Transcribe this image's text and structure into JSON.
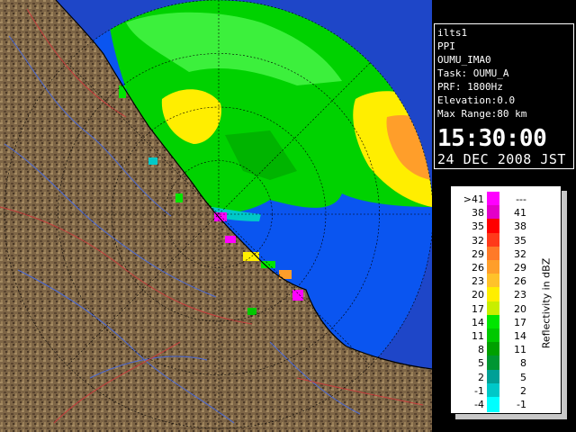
{
  "info": {
    "lines": [
      "ilts1",
      "PPI",
      "OUMU_IMA0",
      "Task: OUMU_A",
      "PRF: 1800Hz",
      "Elevation:0.0",
      "Max Range:80 km"
    ],
    "time": "15:30:00",
    "date": "24 DEC 2008 JST"
  },
  "legend": {
    "unit_label": "Reflectivity in dBZ",
    "rows": [
      {
        "lo": ">41",
        "hi": "---",
        "color": "#ff00ff"
      },
      {
        "lo": "38",
        "hi": "41",
        "color": "#e300c9"
      },
      {
        "lo": "35",
        "hi": "38",
        "color": "#ff0000"
      },
      {
        "lo": "32",
        "hi": "35",
        "color": "#ff3a1a"
      },
      {
        "lo": "29",
        "hi": "32",
        "color": "#ff7a28"
      },
      {
        "lo": "26",
        "hi": "29",
        "color": "#ff9e2a"
      },
      {
        "lo": "23",
        "hi": "26",
        "color": "#ffc22a"
      },
      {
        "lo": "20",
        "hi": "23",
        "color": "#ffee00"
      },
      {
        "lo": "17",
        "hi": "20",
        "color": "#c8ee00"
      },
      {
        "lo": "14",
        "hi": "17",
        "color": "#00e600"
      },
      {
        "lo": "11",
        "hi": "14",
        "color": "#00c800"
      },
      {
        "lo": "8",
        "hi": "11",
        "color": "#00a000"
      },
      {
        "lo": "5",
        "hi": "8",
        "color": "#009632"
      },
      {
        "lo": "2",
        "hi": "5",
        "color": "#00a096"
      },
      {
        "lo": "-1",
        "hi": "2",
        "color": "#00c8c8"
      },
      {
        "lo": "-4",
        "hi": "-1",
        "color": "#00ffff"
      }
    ]
  },
  "colors": {
    "land": "#7d6546",
    "sea": "#0a55f0",
    "range_outside": "#1e46c8",
    "grid": "#000000"
  }
}
